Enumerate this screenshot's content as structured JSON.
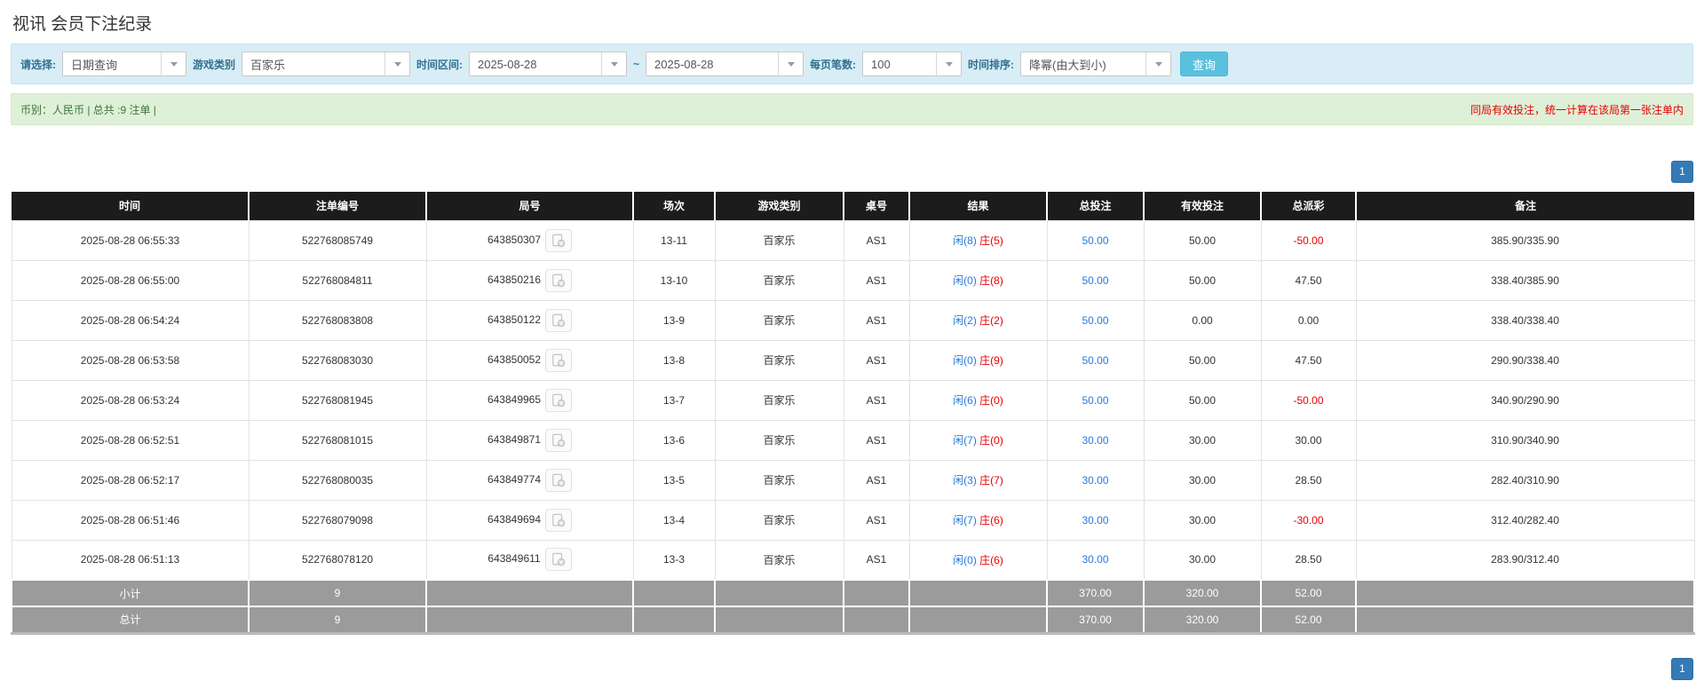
{
  "page": {
    "title": "视讯 会员下注纪录"
  },
  "filters": {
    "select_label": "请选择:",
    "select_value": "日期查询",
    "game_label": "游戏类别",
    "game_value": "百家乐",
    "range_label": "时间区间:",
    "date_from": "2025-08-28",
    "tilde": "~",
    "date_to": "2025-08-28",
    "page_size_label": "每页笔数:",
    "page_size_value": "100",
    "sort_label": "时间排序:",
    "sort_value": "降幂(由大到小)",
    "search_button": "查询"
  },
  "summary": {
    "left": "币别：人民币 | 总共 :9 注单 |",
    "right": "同局有效投注，统一计算在该局第一张注单内"
  },
  "pagination": {
    "page": "1"
  },
  "colors": {
    "header_bg": "#1c1c1c",
    "link_blue": "#2979d9",
    "player_blue": "#2979d9",
    "banker_red": "#e60000",
    "notice_red": "#e60000",
    "query_button_blue": "#5bc0de",
    "pager_blue": "#337ab7",
    "filter_panel_blue": "#d9edf7",
    "summary_green_bg": "#dff0d8",
    "summary_green_text": "#3c763d",
    "footer_gray": "#9b9b9b"
  },
  "icons": {
    "dropdown": "chevron-down-icon",
    "video": "video-replay-icon"
  },
  "table": {
    "headers": [
      "时间",
      "注单编号",
      "局号",
      "场次",
      "游戏类别",
      "桌号",
      "结果",
      "总投注",
      "有效投注",
      "总派彩",
      "备注"
    ],
    "rows": [
      {
        "time": "2025-08-28 06:55:33",
        "bet_id": "522768085749",
        "round_id": "643850307",
        "session": "13-11",
        "game": "百家乐",
        "table_no": "AS1",
        "result_player": "闲(8)",
        "result_banker": "庄(5)",
        "total_bet": "50.00",
        "valid_bet": "50.00",
        "payout": "-50.00",
        "note": "385.90/335.90"
      },
      {
        "time": "2025-08-28 06:55:00",
        "bet_id": "522768084811",
        "round_id": "643850216",
        "session": "13-10",
        "game": "百家乐",
        "table_no": "AS1",
        "result_player": "闲(0)",
        "result_banker": "庄(8)",
        "total_bet": "50.00",
        "valid_bet": "50.00",
        "payout": "47.50",
        "note": "338.40/385.90"
      },
      {
        "time": "2025-08-28 06:54:24",
        "bet_id": "522768083808",
        "round_id": "643850122",
        "session": "13-9",
        "game": "百家乐",
        "table_no": "AS1",
        "result_player": "闲(2)",
        "result_banker": "庄(2)",
        "total_bet": "50.00",
        "valid_bet": "0.00",
        "payout": "0.00",
        "note": "338.40/338.40"
      },
      {
        "time": "2025-08-28 06:53:58",
        "bet_id": "522768083030",
        "round_id": "643850052",
        "session": "13-8",
        "game": "百家乐",
        "table_no": "AS1",
        "result_player": "闲(0)",
        "result_banker": "庄(9)",
        "total_bet": "50.00",
        "valid_bet": "50.00",
        "payout": "47.50",
        "note": "290.90/338.40"
      },
      {
        "time": "2025-08-28 06:53:24",
        "bet_id": "522768081945",
        "round_id": "643849965",
        "session": "13-7",
        "game": "百家乐",
        "table_no": "AS1",
        "result_player": "闲(6)",
        "result_banker": "庄(0)",
        "total_bet": "50.00",
        "valid_bet": "50.00",
        "payout": "-50.00",
        "note": "340.90/290.90"
      },
      {
        "time": "2025-08-28 06:52:51",
        "bet_id": "522768081015",
        "round_id": "643849871",
        "session": "13-6",
        "game": "百家乐",
        "table_no": "AS1",
        "result_player": "闲(7)",
        "result_banker": "庄(0)",
        "total_bet": "30.00",
        "valid_bet": "30.00",
        "payout": "30.00",
        "note": "310.90/340.90"
      },
      {
        "time": "2025-08-28 06:52:17",
        "bet_id": "522768080035",
        "round_id": "643849774",
        "session": "13-5",
        "game": "百家乐",
        "table_no": "AS1",
        "result_player": "闲(3)",
        "result_banker": "庄(7)",
        "total_bet": "30.00",
        "valid_bet": "30.00",
        "payout": "28.50",
        "note": "282.40/310.90"
      },
      {
        "time": "2025-08-28 06:51:46",
        "bet_id": "522768079098",
        "round_id": "643849694",
        "session": "13-4",
        "game": "百家乐",
        "table_no": "AS1",
        "result_player": "闲(7)",
        "result_banker": "庄(6)",
        "total_bet": "30.00",
        "valid_bet": "30.00",
        "payout": "-30.00",
        "note": "312.40/282.40"
      },
      {
        "time": "2025-08-28 06:51:13",
        "bet_id": "522768078120",
        "round_id": "643849611",
        "session": "13-3",
        "game": "百家乐",
        "table_no": "AS1",
        "result_player": "闲(0)",
        "result_banker": "庄(6)",
        "total_bet": "30.00",
        "valid_bet": "30.00",
        "payout": "28.50",
        "note": "283.90/312.40"
      }
    ],
    "subtotal": {
      "label": "小计",
      "count": "9",
      "total_bet": "370.00",
      "valid_bet": "320.00",
      "payout": "52.00"
    },
    "total": {
      "label": "总计",
      "count": "9",
      "total_bet": "370.00",
      "valid_bet": "320.00",
      "payout": "52.00"
    }
  }
}
